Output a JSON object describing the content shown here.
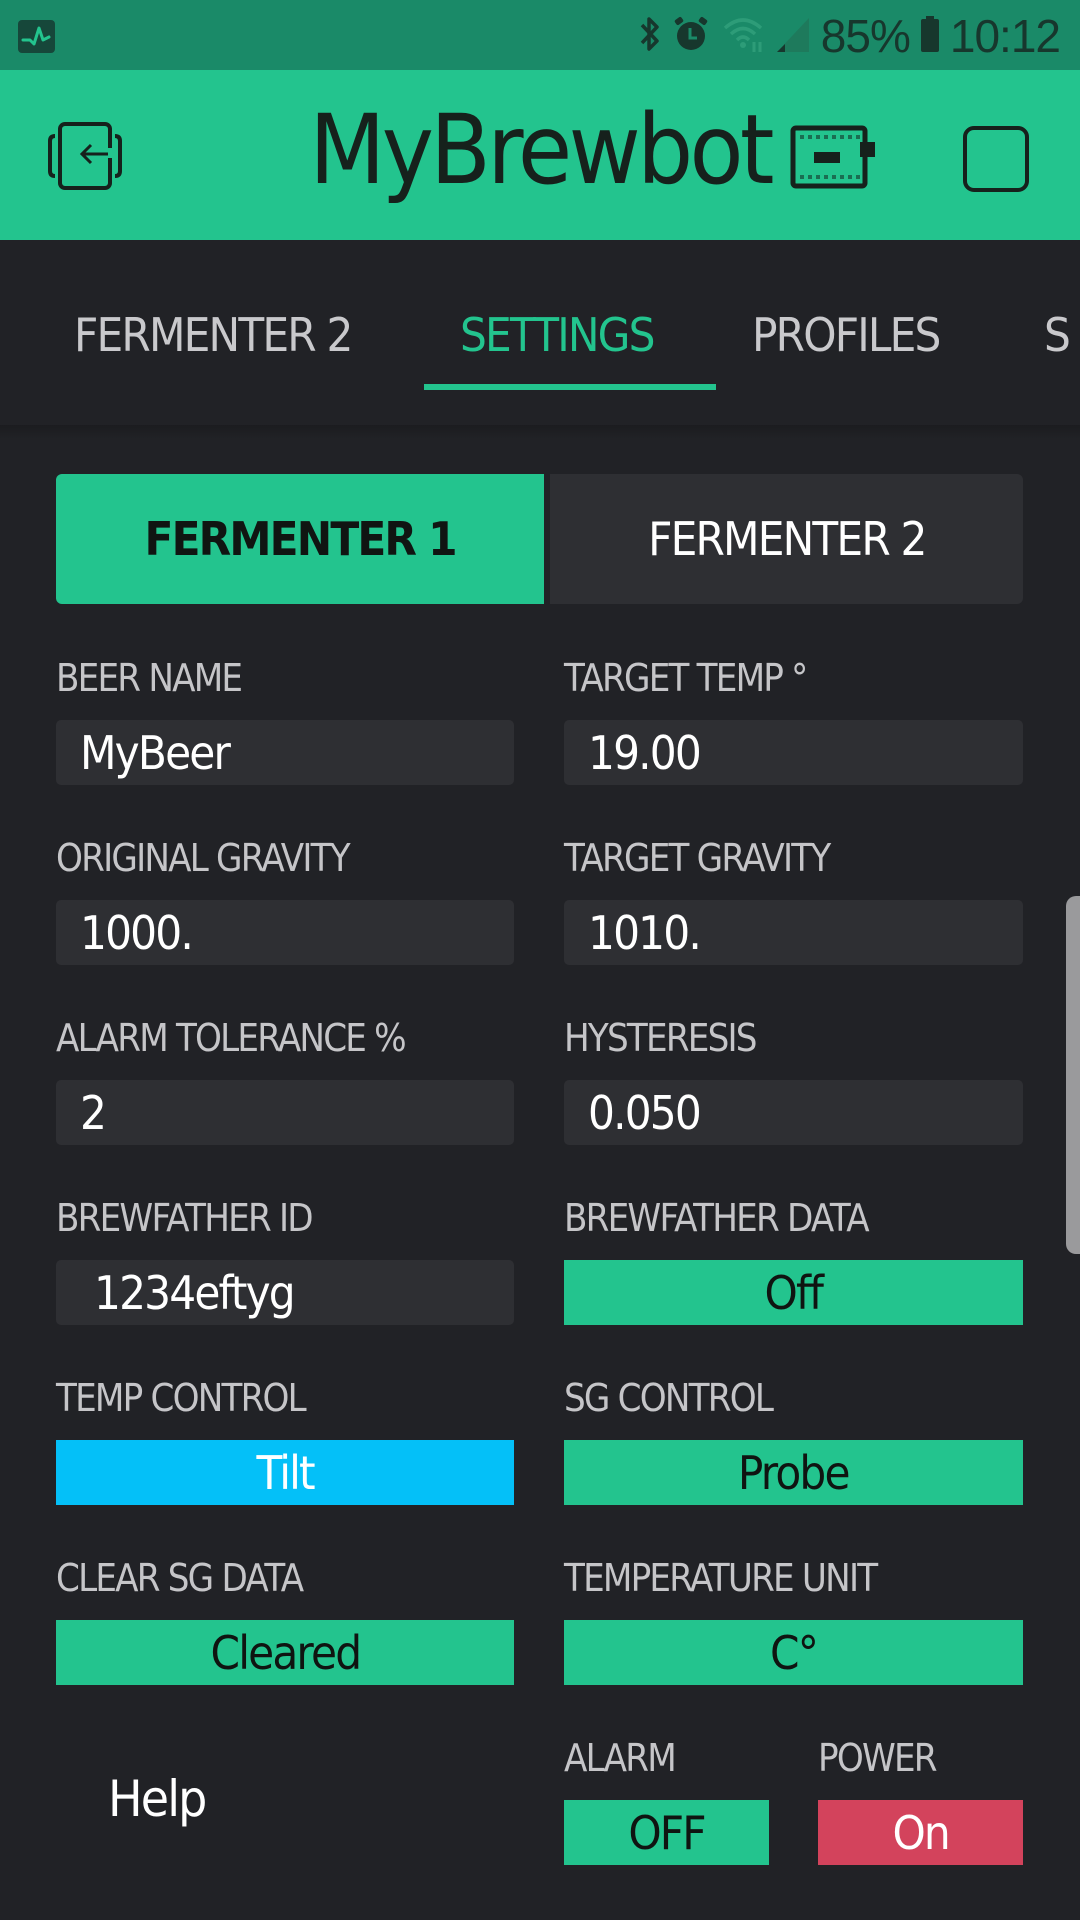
{
  "status_bar": {
    "app_icon": "pulse-icon",
    "icons": [
      "bluetooth-icon",
      "alarm-clock-icon",
      "wifi-icon",
      "cell-signal-icon"
    ],
    "battery_percent": "85%",
    "battery_icon": "battery-icon",
    "time": "10:12"
  },
  "header": {
    "title": "MyBrewbot",
    "left_icon": "exit-device-icon",
    "right_icons": [
      "device-board-icon",
      "square-icon"
    ],
    "colors": {
      "accent": "#23c48e",
      "status_bar": "#1a8a68"
    }
  },
  "tabs": {
    "items": [
      {
        "label": "FERMENTER 2",
        "active": false
      },
      {
        "label": "SETTINGS",
        "active": true
      },
      {
        "label": "PROFILES",
        "active": false
      },
      {
        "label": "S",
        "active": false
      }
    ]
  },
  "segmented": {
    "options": [
      {
        "label": "FERMENTER 1",
        "selected": true
      },
      {
        "label": "FERMENTER 2",
        "selected": false
      }
    ]
  },
  "fields": {
    "beer_name": {
      "label": "BEER NAME",
      "value": "MyBeer"
    },
    "target_temp": {
      "label": "TARGET TEMP °",
      "value": "19.00"
    },
    "original_gravity": {
      "label": "ORIGINAL GRAVITY",
      "value": "1000."
    },
    "target_gravity": {
      "label": "TARGET GRAVITY",
      "value": "1010."
    },
    "alarm_tolerance": {
      "label": "ALARM TOLERANCE %",
      "value": "2"
    },
    "hysteresis": {
      "label": "HYSTERESIS",
      "value": "0.050"
    },
    "brewfather_id": {
      "label": "BREWFATHER ID",
      "value": "1234eftyg"
    },
    "brewfather_data": {
      "label": "BREWFATHER DATA",
      "value": "Off"
    },
    "temp_control": {
      "label": "TEMP CONTROL",
      "value": "Tilt"
    },
    "sg_control": {
      "label": "SG CONTROL",
      "value": "Probe"
    },
    "clear_sg_data": {
      "label": "CLEAR SG DATA",
      "value": "Cleared"
    },
    "temperature_unit": {
      "label": "TEMPERATURE UNIT",
      "value": "C°"
    },
    "alarm": {
      "label": "ALARM",
      "value": "OFF"
    },
    "power": {
      "label": "POWER",
      "value": "On"
    }
  },
  "help": {
    "label": "Help"
  },
  "colors": {
    "green": "#23c48e",
    "blue": "#04c0f8",
    "red": "#d3435c",
    "background": "#212226",
    "input": "#2e2f33"
  }
}
